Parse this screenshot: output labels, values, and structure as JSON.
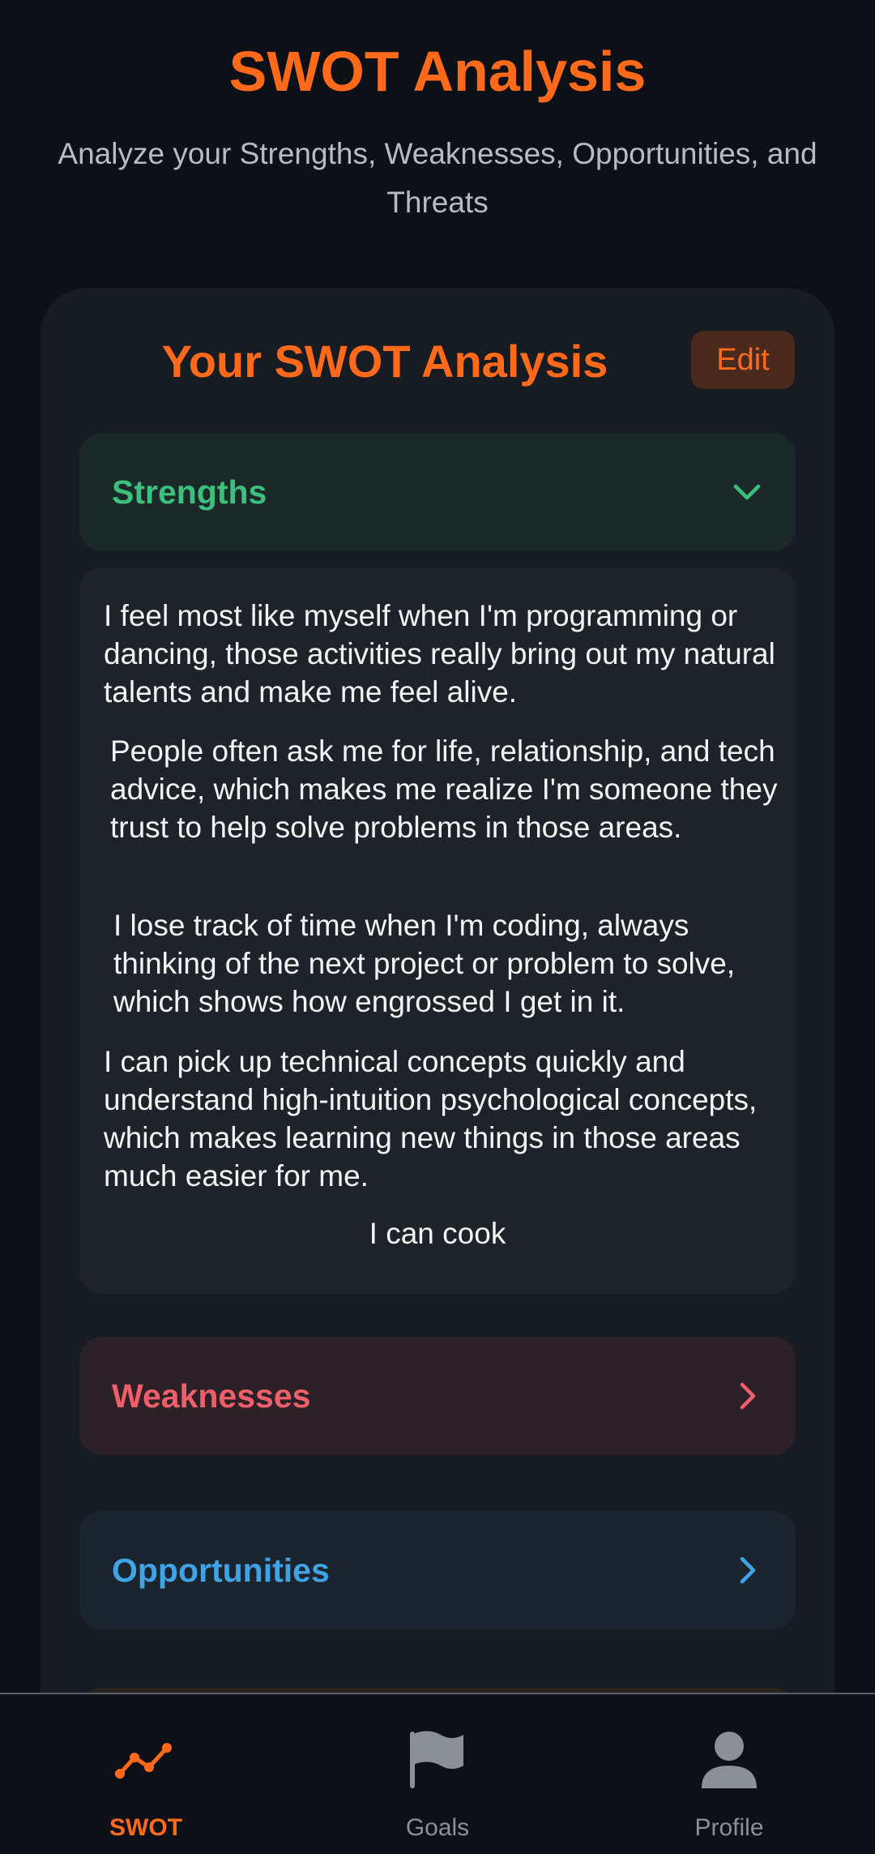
{
  "header": {
    "title": "SWOT Analysis",
    "subtitle": "Analyze your Strengths, Weaknesses, Opportunities, and Threats"
  },
  "card": {
    "title": "Your SWOT Analysis",
    "edit_label": "Edit"
  },
  "sections": {
    "strengths": {
      "label": "Strengths",
      "expanded": true,
      "icon": "chevron-down-icon",
      "color": "#3cc07d",
      "items": [
        "I feel most like myself when I'm programming or dancing, those activities really bring out my natural talents and make me feel alive.",
        "People often ask me for life, relationship, and tech advice, which makes me realize I'm someone they trust to help solve problems in those areas.",
        "I lose track of time when I'm coding, always thinking of the next project or problem to solve, which shows how engrossed I get in it.",
        "I can pick up technical concepts quickly and understand high-intuition psychological concepts, which makes learning new things in those areas much easier for me.",
        "I can cook"
      ]
    },
    "weaknesses": {
      "label": "Weaknesses",
      "expanded": false,
      "icon": "chevron-right-icon",
      "color": "#ef5f6a"
    },
    "opportunities": {
      "label": "Opportunities",
      "expanded": false,
      "icon": "chevron-right-icon",
      "color": "#3fa4e6"
    }
  },
  "nav": {
    "items": [
      {
        "label": "SWOT",
        "icon": "trend-line-icon",
        "active": true
      },
      {
        "label": "Goals",
        "icon": "flag-icon",
        "active": false
      },
      {
        "label": "Profile",
        "icon": "user-icon",
        "active": false
      }
    ]
  },
  "colors": {
    "accent": "#ff6a1a",
    "background": "#0d1117",
    "card": "#171b22"
  }
}
